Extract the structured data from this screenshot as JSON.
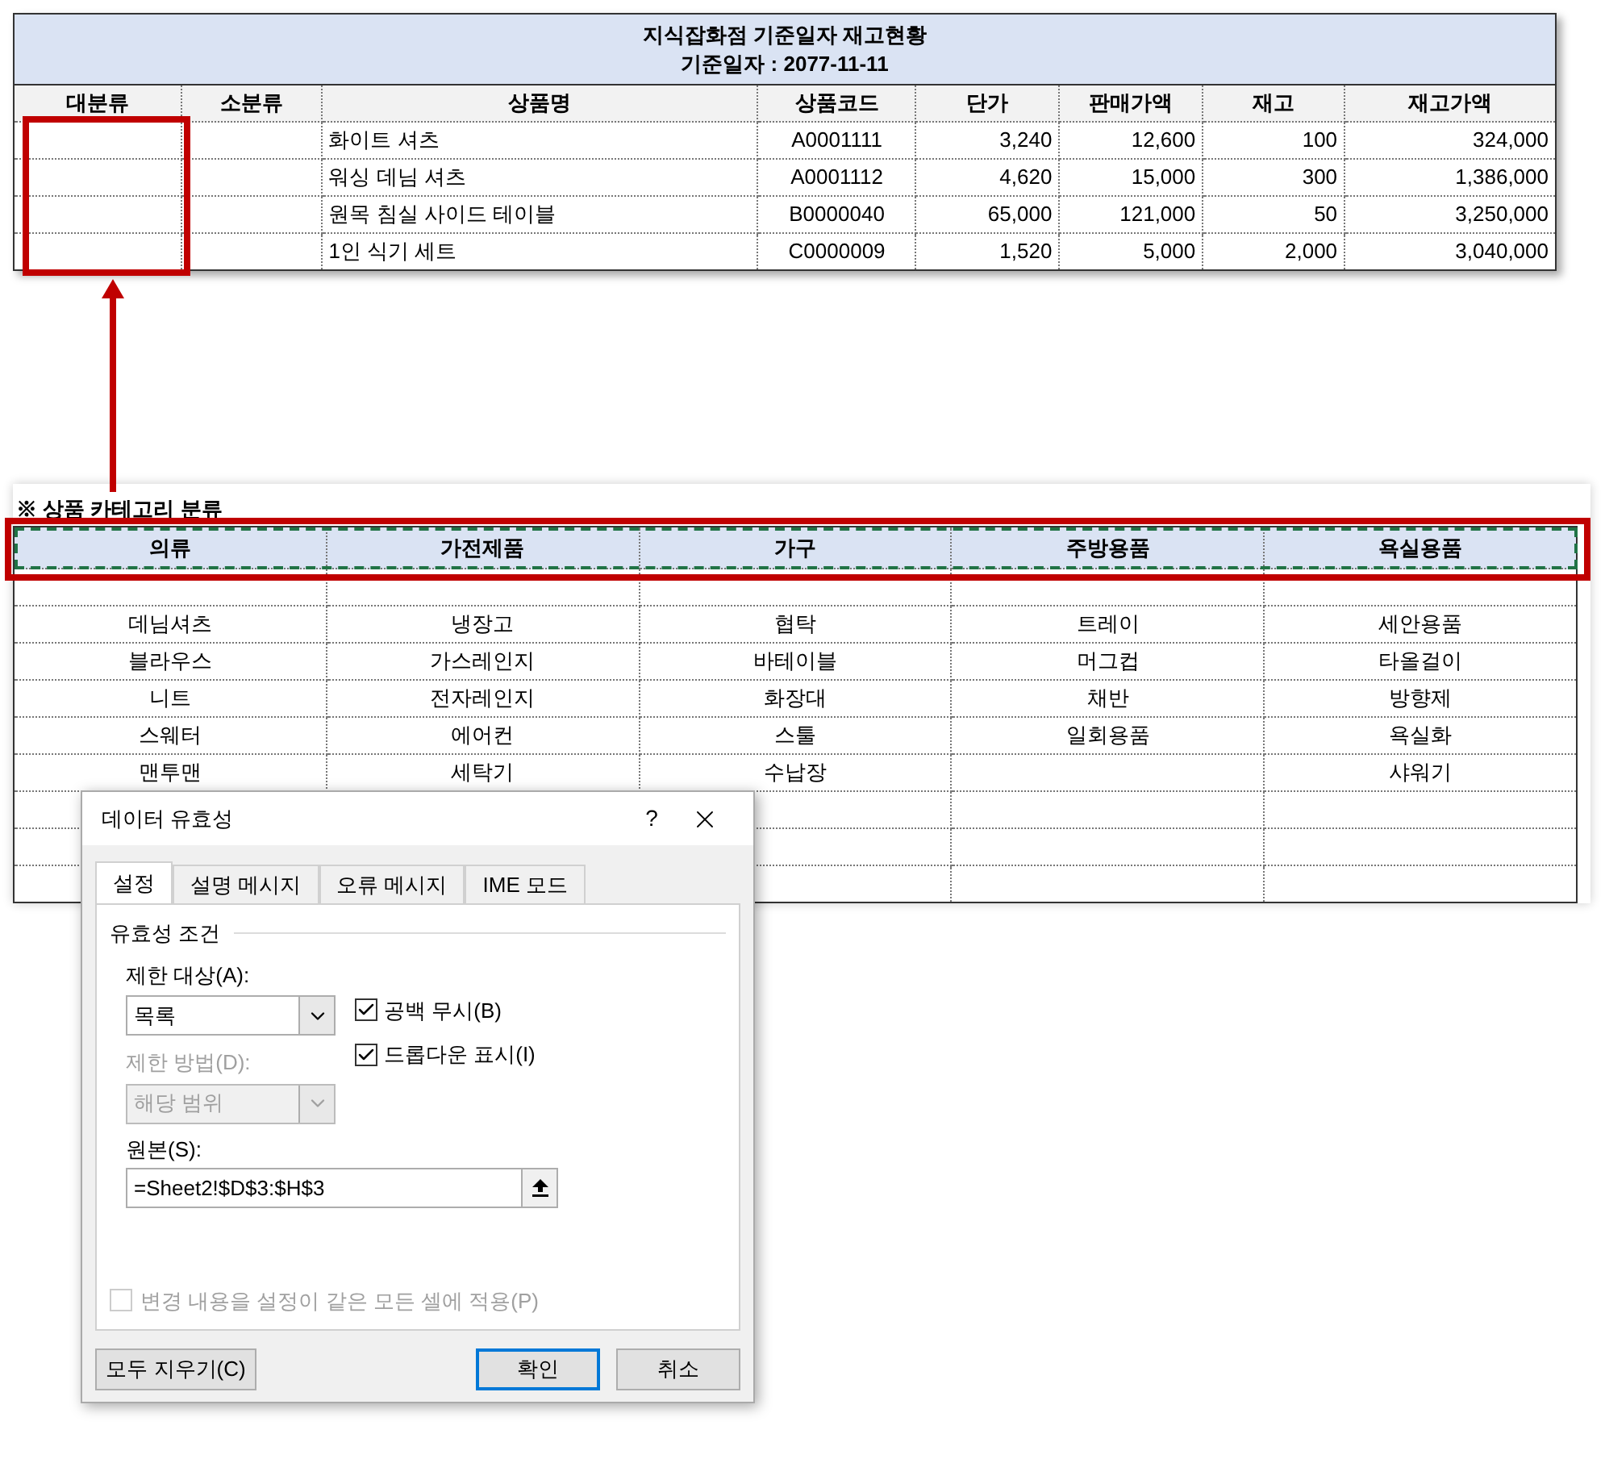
{
  "inventory_sheet": {
    "title": "지식잡화점 기준일자 재고현황",
    "subtitle": "기준일자 : 2077-11-11",
    "columns": [
      "대분류",
      "소분류",
      "상품명",
      "상품코드",
      "단가",
      "판매가액",
      "재고",
      "재고가액"
    ],
    "rows": [
      [
        null,
        null,
        "화이트 셔츠",
        "A0001111",
        "3,240",
        "12,600",
        "100",
        "324,000"
      ],
      [
        null,
        null,
        "워싱 데님 셔츠",
        "A0001112",
        "4,620",
        "15,000",
        "300",
        "1,386,000"
      ],
      [
        null,
        null,
        "원목 침실 사이드 테이블",
        "B0000040",
        "65,000",
        "121,000",
        "50",
        "3,250,000"
      ],
      [
        null,
        null,
        "1인 식기 세트",
        "C0000009",
        "1,520",
        "5,000",
        "2,000",
        "3,040,000"
      ]
    ]
  },
  "category_sheet": {
    "label": "※ 상품 카테고리 분류",
    "header_marquee": true,
    "columns": [
      "의류",
      "가전제품",
      "가구",
      "주방용품",
      "욕실용품"
    ],
    "rows": [
      [
        null,
        null,
        null,
        null,
        null
      ],
      [
        "데님셔츠",
        "냉장고",
        "협탁",
        "트레이",
        "세안용품"
      ],
      [
        "블라우스",
        "가스레인지",
        "바테이블",
        "머그컵",
        "타올걸이"
      ],
      [
        "니트",
        "전자레인지",
        "화장대",
        "채반",
        "방향제"
      ],
      [
        "스웨터",
        "에어컨",
        "스툴",
        "일회용품",
        "욕실화"
      ],
      [
        "맨투맨",
        "세탁기",
        "수납장",
        null,
        "샤워기"
      ],
      [
        null,
        null,
        null,
        null,
        null
      ],
      [
        null,
        null,
        null,
        null,
        null
      ],
      [
        null,
        null,
        null,
        null,
        null
      ]
    ]
  },
  "dialog": {
    "title": "데이터 유효성",
    "help": "?",
    "tabs": [
      {
        "label": "설정",
        "selected": true
      },
      {
        "label": "설명 메시지",
        "selected": false
      },
      {
        "label": "오류 메시지",
        "selected": false
      },
      {
        "label": "IME 모드",
        "selected": false
      }
    ],
    "section": "유효성 조건",
    "allow": {
      "label": "제한 대상(A):",
      "value": "목록",
      "disabled": false
    },
    "data": {
      "label": "제한 방법(D):",
      "value": "해당 범위",
      "disabled": true
    },
    "checkboxes": [
      {
        "label": "공백 무시(B)",
        "checked": true
      },
      {
        "label": "드롭다운 표시(I)",
        "checked": true
      }
    ],
    "source": {
      "label": "원본(S):",
      "value": "=Sheet2!$D$3:$H$3"
    },
    "apply_all": {
      "label": "변경 내용을 설정이 같은 모든 셀에 적용(P)",
      "checked": false,
      "disabled": true
    },
    "buttons": [
      {
        "label": "모두 지우기(C)",
        "default": false
      },
      {
        "label": "확인",
        "default": true
      },
      {
        "label": "취소",
        "default": false
      }
    ]
  }
}
